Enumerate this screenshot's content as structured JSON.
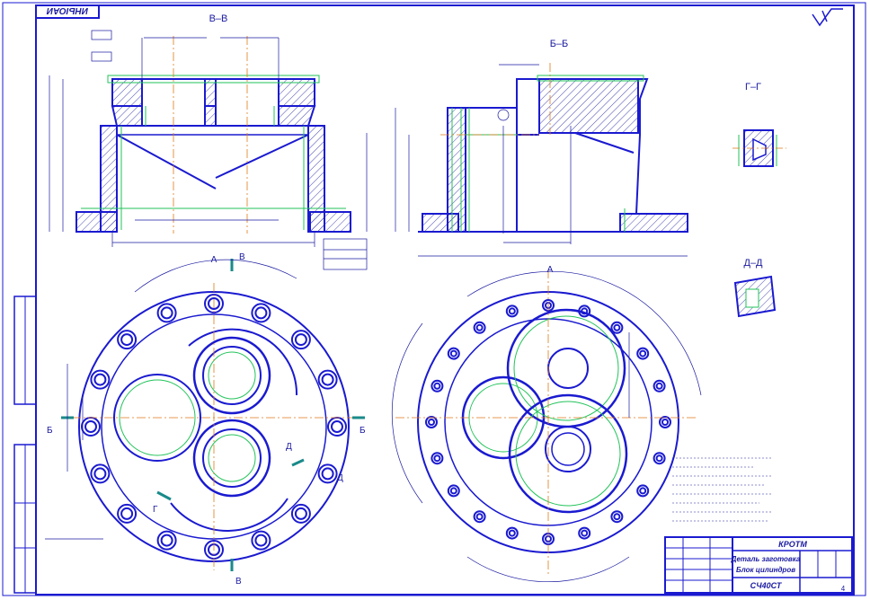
{
  "drawing": {
    "stamp_code": "ИНЫОАИ",
    "sections": {
      "vv": "В–В",
      "bb": "Б–Б",
      "gg": "Г–Г",
      "dd": "Д–Д"
    },
    "markers": {
      "a_top": "А",
      "a_right": "А",
      "v_top": "В",
      "v_bottom": "В",
      "b_left": "Б",
      "b_right": "Б",
      "g": "Г",
      "d1": "Д",
      "d2": "Д"
    },
    "title_block": {
      "org": "КРОТМ",
      "part_line1": "Деталь заготовка",
      "part_line2": "Блок цилиндров",
      "material": "СЧ40СТ",
      "sheet": "4"
    },
    "colors": {
      "outline": "#1a1ad0",
      "thin": "#1a1aa0",
      "hidden": "#22c35a",
      "center": "#e07a1a"
    }
  }
}
